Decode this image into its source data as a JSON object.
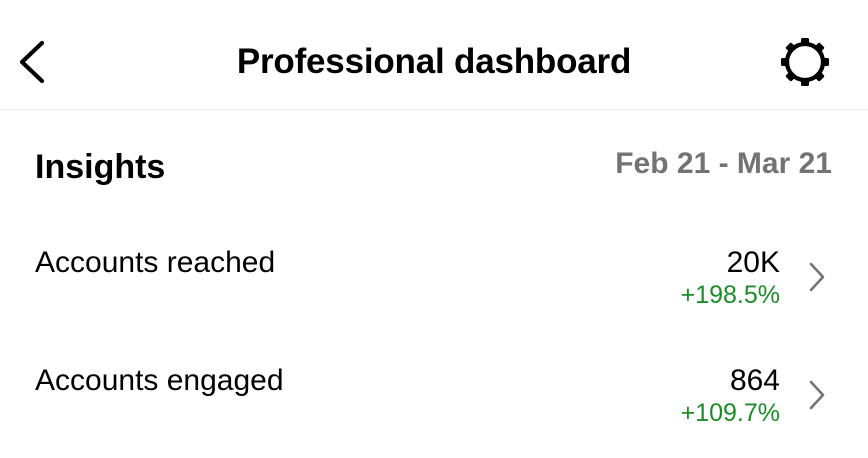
{
  "header": {
    "title": "Professional dashboard",
    "back_icon": "chevron-left-icon",
    "settings_icon": "gear-icon"
  },
  "insights": {
    "title": "Insights",
    "date_range": "Feb 21 - Mar 21",
    "rows": [
      {
        "label": "Accounts reached",
        "value": "20K",
        "change": "+198.5%"
      },
      {
        "label": "Accounts engaged",
        "value": "864",
        "change": "+109.7%"
      }
    ]
  },
  "colors": {
    "positive_change": "#1f8a2a",
    "secondary_text": "#737373",
    "divider": "#e6e6e6"
  }
}
